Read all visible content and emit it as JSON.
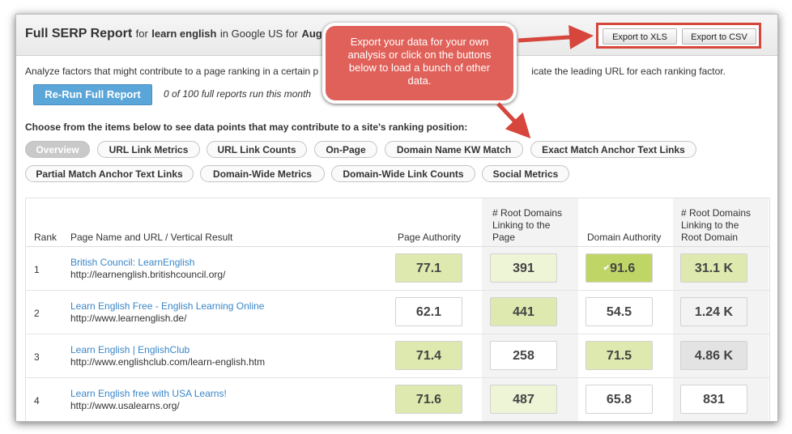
{
  "header": {
    "title_bold": "Full SERP Report",
    "title_for": "for",
    "keyword": "learn english",
    "title_in": "in Google US for",
    "date_partial": "Augu",
    "export_xls": "Export to XLS",
    "export_csv": "Export to CSV"
  },
  "intro_left": "Analyze factors that might contribute to a page ranking in a certain p",
  "intro_right": "icate the leading URL for each ranking factor.",
  "rerun_label": "Re-Run Full Report",
  "runs_text": "0 of 100 full reports run this month",
  "choose_text": "Choose from the items below to see data points that may contribute to a site's ranking position:",
  "tabs": [
    "Overview",
    "URL Link Metrics",
    "URL Link Counts",
    "On-Page",
    "Domain Name KW Match",
    "Exact Match Anchor Text Links",
    "Partial Match Anchor Text Links",
    "Domain-Wide Metrics",
    "Domain-Wide Link Counts",
    "Social Metrics"
  ],
  "table": {
    "headers": {
      "rank": "Rank",
      "page": "Page Name and URL / Vertical Result",
      "pa": "Page Authority",
      "rd_page": [
        "# Root Domains",
        "Linking to the",
        "Page"
      ],
      "da": "Domain Authority",
      "rd_domain": [
        "# Root Domains",
        "Linking to the",
        "Root Domain"
      ]
    },
    "rows": [
      {
        "rank": "1",
        "title": "British Council: LearnEnglish",
        "url": "http://learnenglish.britishcouncil.org/",
        "pa": "77.1",
        "rdp": "391",
        "da": "91.6",
        "rdd": "31.1 K"
      },
      {
        "rank": "2",
        "title": "Learn English Free - English Learning Online",
        "url": "http://www.learnenglish.de/",
        "pa": "62.1",
        "rdp": "441",
        "da": "54.5",
        "rdd": "1.24 K"
      },
      {
        "rank": "3",
        "title": "Learn English | EnglishClub",
        "url": "http://www.englishclub.com/learn-english.htm",
        "pa": "71.4",
        "rdp": "258",
        "da": "71.5",
        "rdd": "4.86 K"
      },
      {
        "rank": "4",
        "title": "Learn English free with USA Learns!",
        "url": "http://www.usalearns.org/",
        "pa": "71.6",
        "rdp": "487",
        "da": "65.8",
        "rdd": "831"
      }
    ]
  },
  "callout_text": "Export your data for your own analysis or click on the buttons below to load a bunch of other data.",
  "colors": {
    "accent_red": "#e06159",
    "button_blue": "#5aa6d8",
    "link_blue": "#3a86c8",
    "cell_green_light": "#eef4d6",
    "cell_green_mid": "#dde9ae",
    "cell_green_dark": "#bfd566",
    "cell_gray": "#e3e3e3"
  }
}
